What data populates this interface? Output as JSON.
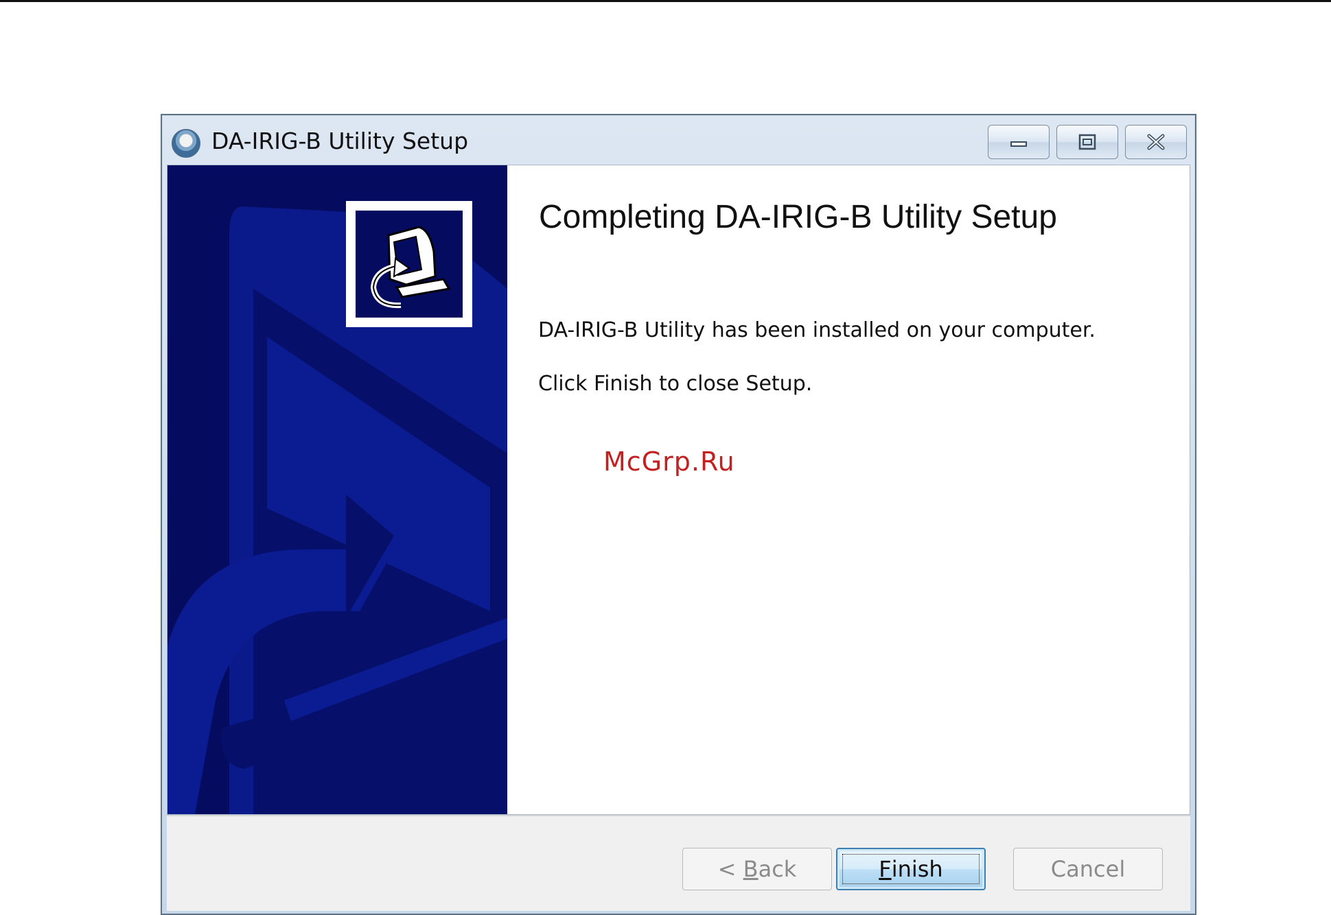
{
  "window": {
    "title": "DA-IRIG-B Utility Setup"
  },
  "content": {
    "heading": "Completing DA-IRIG-B Utility Setup",
    "message_installed": "DA-IRIG-B Utility has been installed on your computer.",
    "message_finish": "Click Finish to close Setup.",
    "watermark": "McGrp.Ru"
  },
  "buttons": {
    "back": {
      "prefix": "< ",
      "accel": "B",
      "rest": "ack",
      "enabled": false
    },
    "finish": {
      "accel": "F",
      "rest": "inish",
      "enabled": true,
      "default": true
    },
    "cancel": {
      "label": "Cancel",
      "enabled": false
    }
  },
  "colors": {
    "side_panel": "#050b5e",
    "side_panel_shapes": "#0a1a8a",
    "watermark": "#c32020",
    "finish_border": "#3c7fb1"
  },
  "icons": [
    "setup-app-icon",
    "minimize-icon",
    "maximize-icon",
    "close-icon",
    "installer-computer-icon"
  ]
}
